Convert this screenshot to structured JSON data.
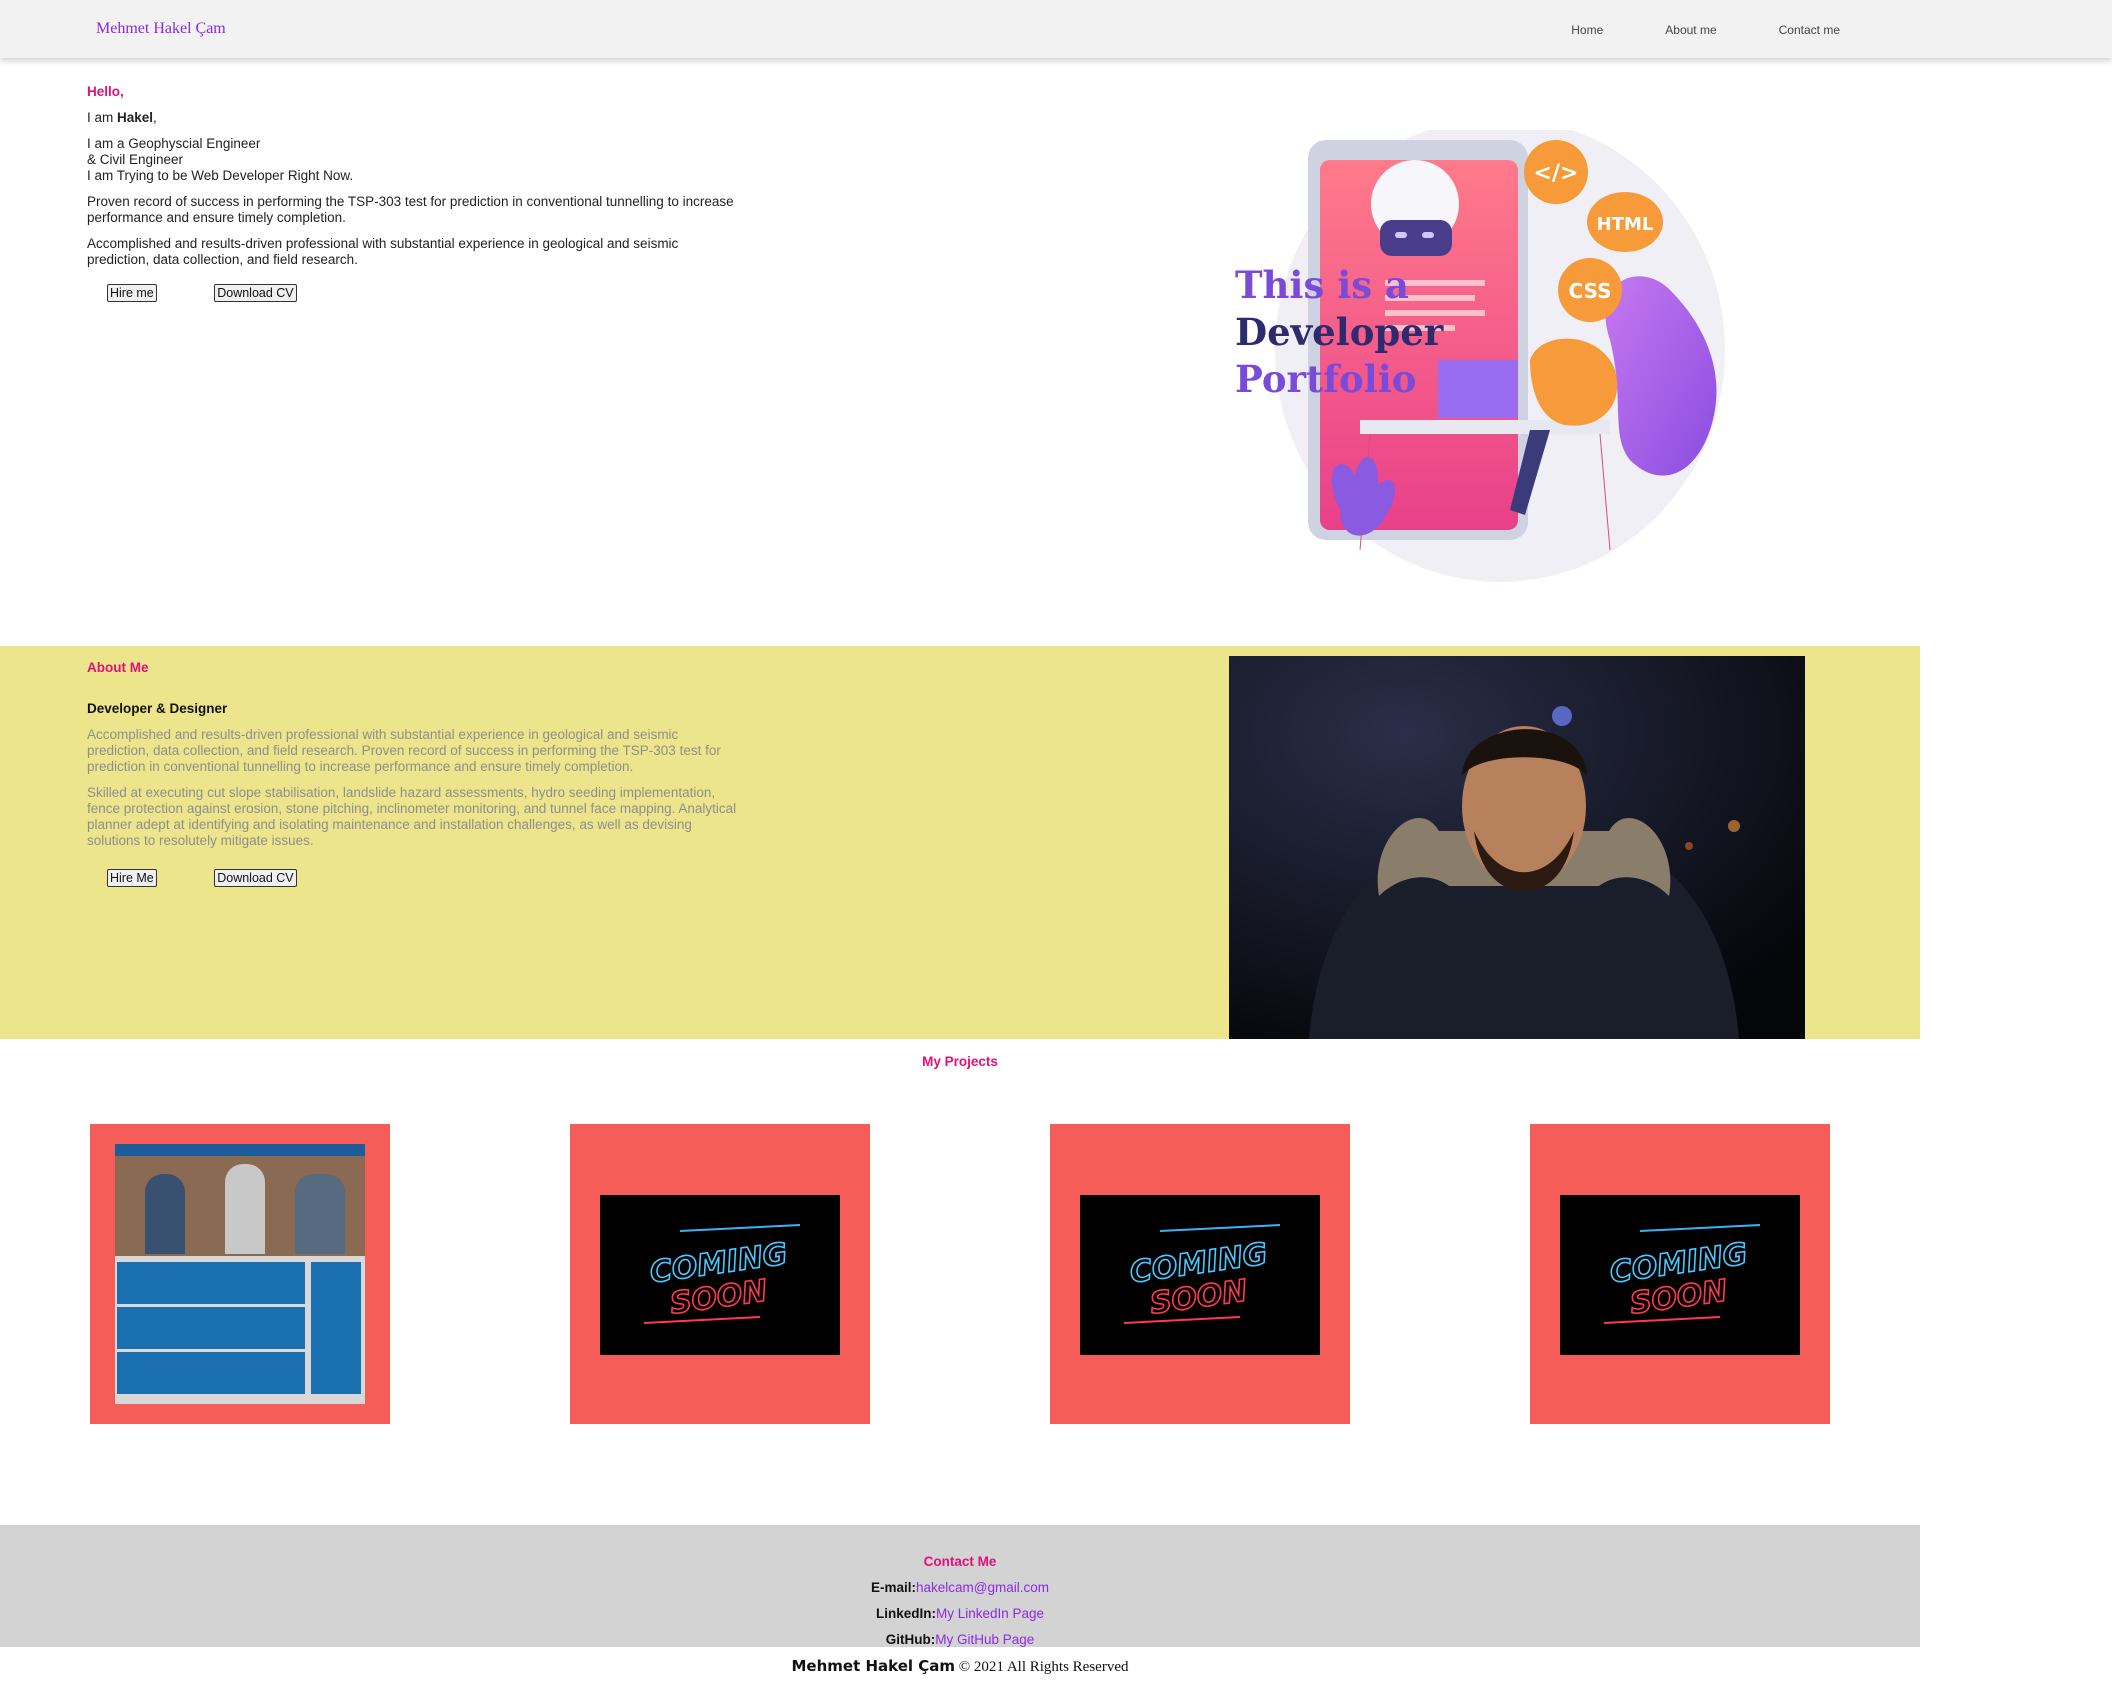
{
  "nav": {
    "brand": "Mehmet Hakel Çam",
    "links": [
      "Home",
      "About me",
      "Contact me"
    ]
  },
  "hero": {
    "hello": "Hello,",
    "iam_prefix": "I am ",
    "name": "Hakel",
    "iam_suffix": ",",
    "role_line1": "I am a Geophyscial Engineer",
    "role_line2": "& Civil Engineer",
    "role_line3": "I am Trying to be Web Developer Right Now.",
    "paragraph1": "Proven record of success in performing the TSP-303 test for prediction in conventional tunnelling to increase performance and ensure timely completion.",
    "paragraph2": "Accomplished and results-driven professional with substantial experience in geological and seismic prediction, data collection, and field research.",
    "hire_button": "Hire me",
    "cv_button": "Download CV",
    "illustration": {
      "line1": "This is a",
      "line2": "Developer",
      "line3": "Portfolio",
      "badge_code": "</>",
      "badge_html": "HTML",
      "badge_css": "CSS"
    }
  },
  "about": {
    "title": "About Me",
    "subtitle": "Developer & Designer",
    "paragraph1": "Accomplished and results-driven professional with substantial experience in geological and seismic prediction, data collection, and field research. Proven record of success in performing the TSP-303 test for prediction in conventional tunnelling to increase performance and ensure timely completion.",
    "paragraph2": "Skilled at executing cut slope stabilisation, landslide hazard assessments, hydro seeding implementation, fence protection against erosion, stone pitching, inclinometer monitoring, and tunnel face mapping. Analytical planner adept at identifying and isolating maintenance and installation challenges, as well as devising solutions to resolutely mitigate issues.",
    "hire_button": "Hire Me",
    "cv_button": "Download CV"
  },
  "projects": {
    "title": "My Projects",
    "coming_soon_line1": "COMING",
    "coming_soon_line2": "SOON"
  },
  "contact": {
    "title": "Contact Me",
    "email_label": "E-mail:",
    "email_value": "hakelcam@gmail.com",
    "linkedin_label": "LinkedIn:",
    "linkedin_value": "My LinkedIn Page",
    "github_label": "GitHub:",
    "github_value": "My GitHub Page"
  },
  "footer": {
    "name": "Mehmet Hakel Çam",
    "rights": " © 2021 All Rights Reserved"
  },
  "colors": {
    "accent_pink": "#e0117a",
    "accent_purple": "#8a2be2",
    "about_bg": "#ede58b",
    "card_bg": "#f65c58",
    "contact_bg": "#d3d3d3"
  }
}
